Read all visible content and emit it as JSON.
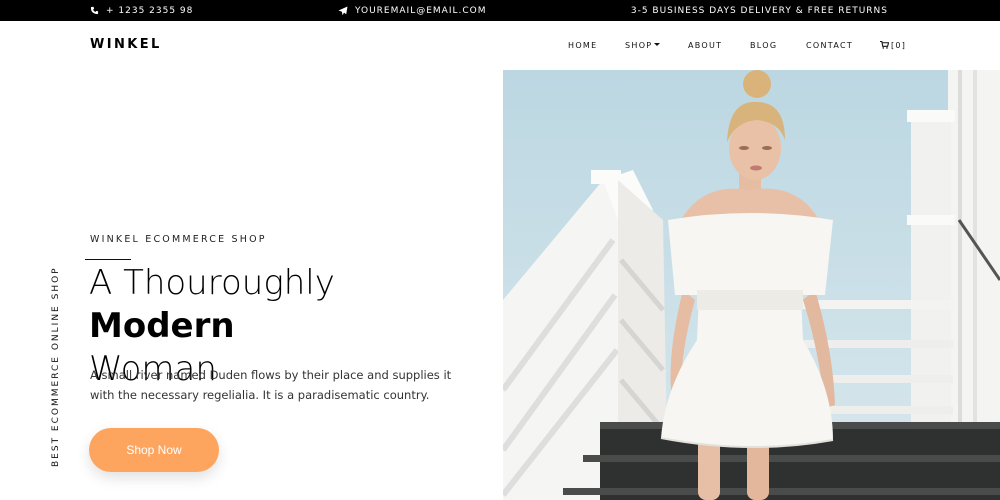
{
  "topbar": {
    "phone": "+ 1235 2355 98",
    "email": "YOUREMAIL@EMAIL.COM",
    "delivery": "3-5 BUSINESS DAYS DELIVERY & FREE RETURNS"
  },
  "nav": {
    "logo": "WINKEL",
    "items": [
      "HOME",
      "SHOP",
      "ABOUT",
      "BLOG",
      "CONTACT"
    ],
    "cart_label": "[0]"
  },
  "hero": {
    "side_text": "BEST ECOMMERCE ONLINE SHOP",
    "eyebrow": "WINKEL ECOMMERCE SHOP",
    "headline_light": "A Thouroughly ",
    "headline_bold": "Modern",
    "headline_tail": "Woman",
    "description": "A small river named Duden flows by their place and supplies it with the necessary regelialia. It is a paradisematic country.",
    "button_label": "Shop Now"
  },
  "colors": {
    "accent": "#fda55f",
    "topbar_bg": "#000000",
    "sky": "#c7dde6"
  }
}
